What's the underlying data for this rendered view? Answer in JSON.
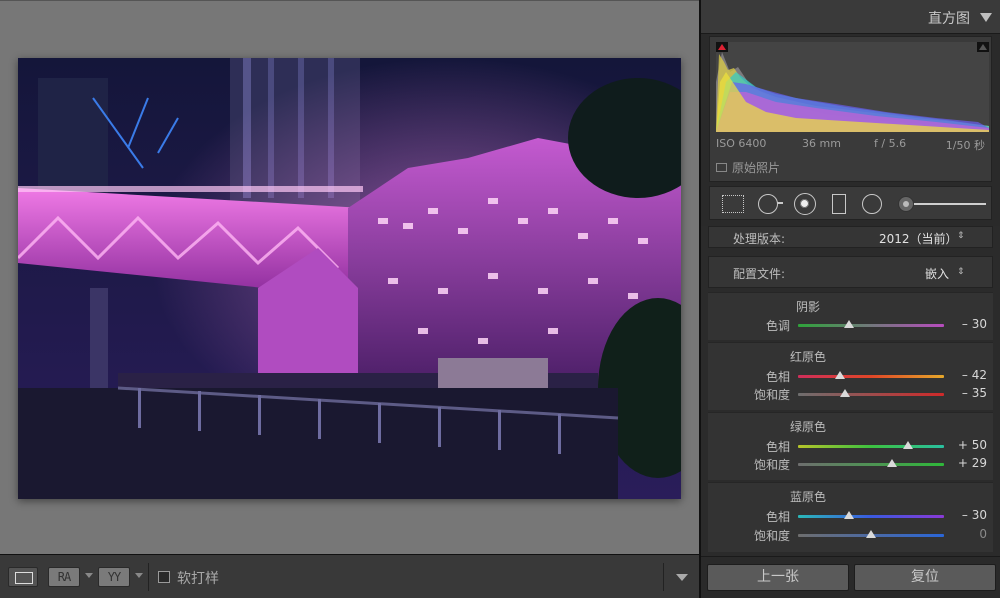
{
  "colors": {
    "viewer_bg": "#777777",
    "panel_bg": "#2a2a2a",
    "accent_magenta": "#d452d8"
  },
  "toolbar": {
    "view_before_after_lr": "RA",
    "view_before_after_tb": "YY",
    "softproof_label": "软打样",
    "softproof_checked": false
  },
  "histogram": {
    "title": "直方图",
    "iso": "ISO 6400",
    "focal": "36 mm",
    "aperture": "f / 5.6",
    "shutter": "1/50 秒",
    "original_photo_label": "原始照片"
  },
  "tools": [
    "crop-overlay",
    "spot-removal",
    "red-eye-correction",
    "graduated-filter",
    "radial-filter",
    "adjustment-brush"
  ],
  "calibration": {
    "process_label": "处理版本:",
    "process_value": "2012（当前）",
    "profile_label": "配置文件:",
    "profile_value": "嵌入",
    "shadows": {
      "title": "阴影",
      "tint_label": "色调",
      "tint_value": "– 30",
      "tint_level": -30
    },
    "red_primary": {
      "title": "红原色",
      "hue_label": "色相",
      "hue_value": "– 42",
      "hue_level": -42,
      "sat_label": "饱和度",
      "sat_value": "– 35",
      "sat_level": -35
    },
    "green_primary": {
      "title": "绿原色",
      "hue_label": "色相",
      "hue_value": "+ 50",
      "hue_level": 50,
      "sat_label": "饱和度",
      "sat_value": "+ 29",
      "sat_level": 29
    },
    "blue_primary": {
      "title": "蓝原色",
      "hue_label": "色相",
      "hue_value": "– 30",
      "hue_level": -30,
      "sat_label": "饱和度",
      "sat_value": "0",
      "sat_level": 0
    }
  },
  "nav": {
    "previous_label": "上一张",
    "reset_label": "复位"
  }
}
